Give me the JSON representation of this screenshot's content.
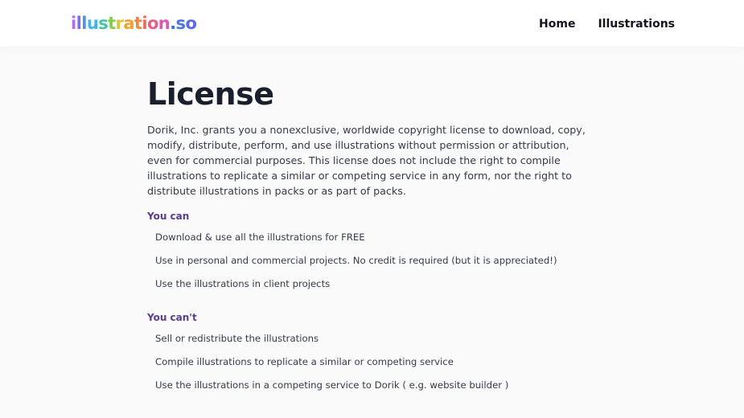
{
  "header": {
    "logo": [
      {
        "text": "i",
        "color": "#b06bf2"
      },
      {
        "text": "l",
        "color": "#7d6cf5"
      },
      {
        "text": "l",
        "color": "#4f8ff7"
      },
      {
        "text": "u",
        "color": "#3fb6ea"
      },
      {
        "text": "s",
        "color": "#44c4a3"
      },
      {
        "text": "t",
        "color": "#7fcf3f"
      },
      {
        "text": "r",
        "color": "#e2c431"
      },
      {
        "text": "a",
        "color": "#f4a12c"
      },
      {
        "text": "t",
        "color": "#f5843a"
      },
      {
        "text": "i",
        "color": "#ef6a5a"
      },
      {
        "text": "o",
        "color": "#ec5d86"
      },
      {
        "text": "n",
        "color": "#e054b5"
      },
      {
        "text": ".",
        "color": "#3d6cf0"
      },
      {
        "text": "s",
        "color": "#4a73f0"
      },
      {
        "text": "o",
        "color": "#5b6af0"
      }
    ],
    "nav": {
      "home": "Home",
      "illustrations": "Illustrations"
    }
  },
  "main": {
    "title": "License",
    "intro": "Dorik, Inc. grants you a nonexclusive, worldwide copyright license to download, copy, modify, distribute, perform, and use illustrations without permission or attribution, even for commercial purposes. This license does not include the right to compile illustrations to replicate a similar or competing service in any form, nor the right to distribute illustrations in packs or as part of packs.",
    "can": {
      "heading": "You can",
      "items": [
        "Download & use all the illustrations for FREE",
        "Use in personal and commercial projects. No credit is required (but it is appreciated!)",
        "Use the illustrations in client projects"
      ]
    },
    "cant": {
      "heading": "You can't",
      "items": [
        "Sell or redistribute the illustrations",
        "Compile illustrations to replicate a similar or competing service",
        "Use the illustrations in a competing service to Dorik ( e.g. website builder )"
      ]
    }
  },
  "colors": {
    "accent": "#5a3c91",
    "title": "#1a1f2e",
    "body_text": "#363a4a",
    "background": "#fafafa"
  }
}
